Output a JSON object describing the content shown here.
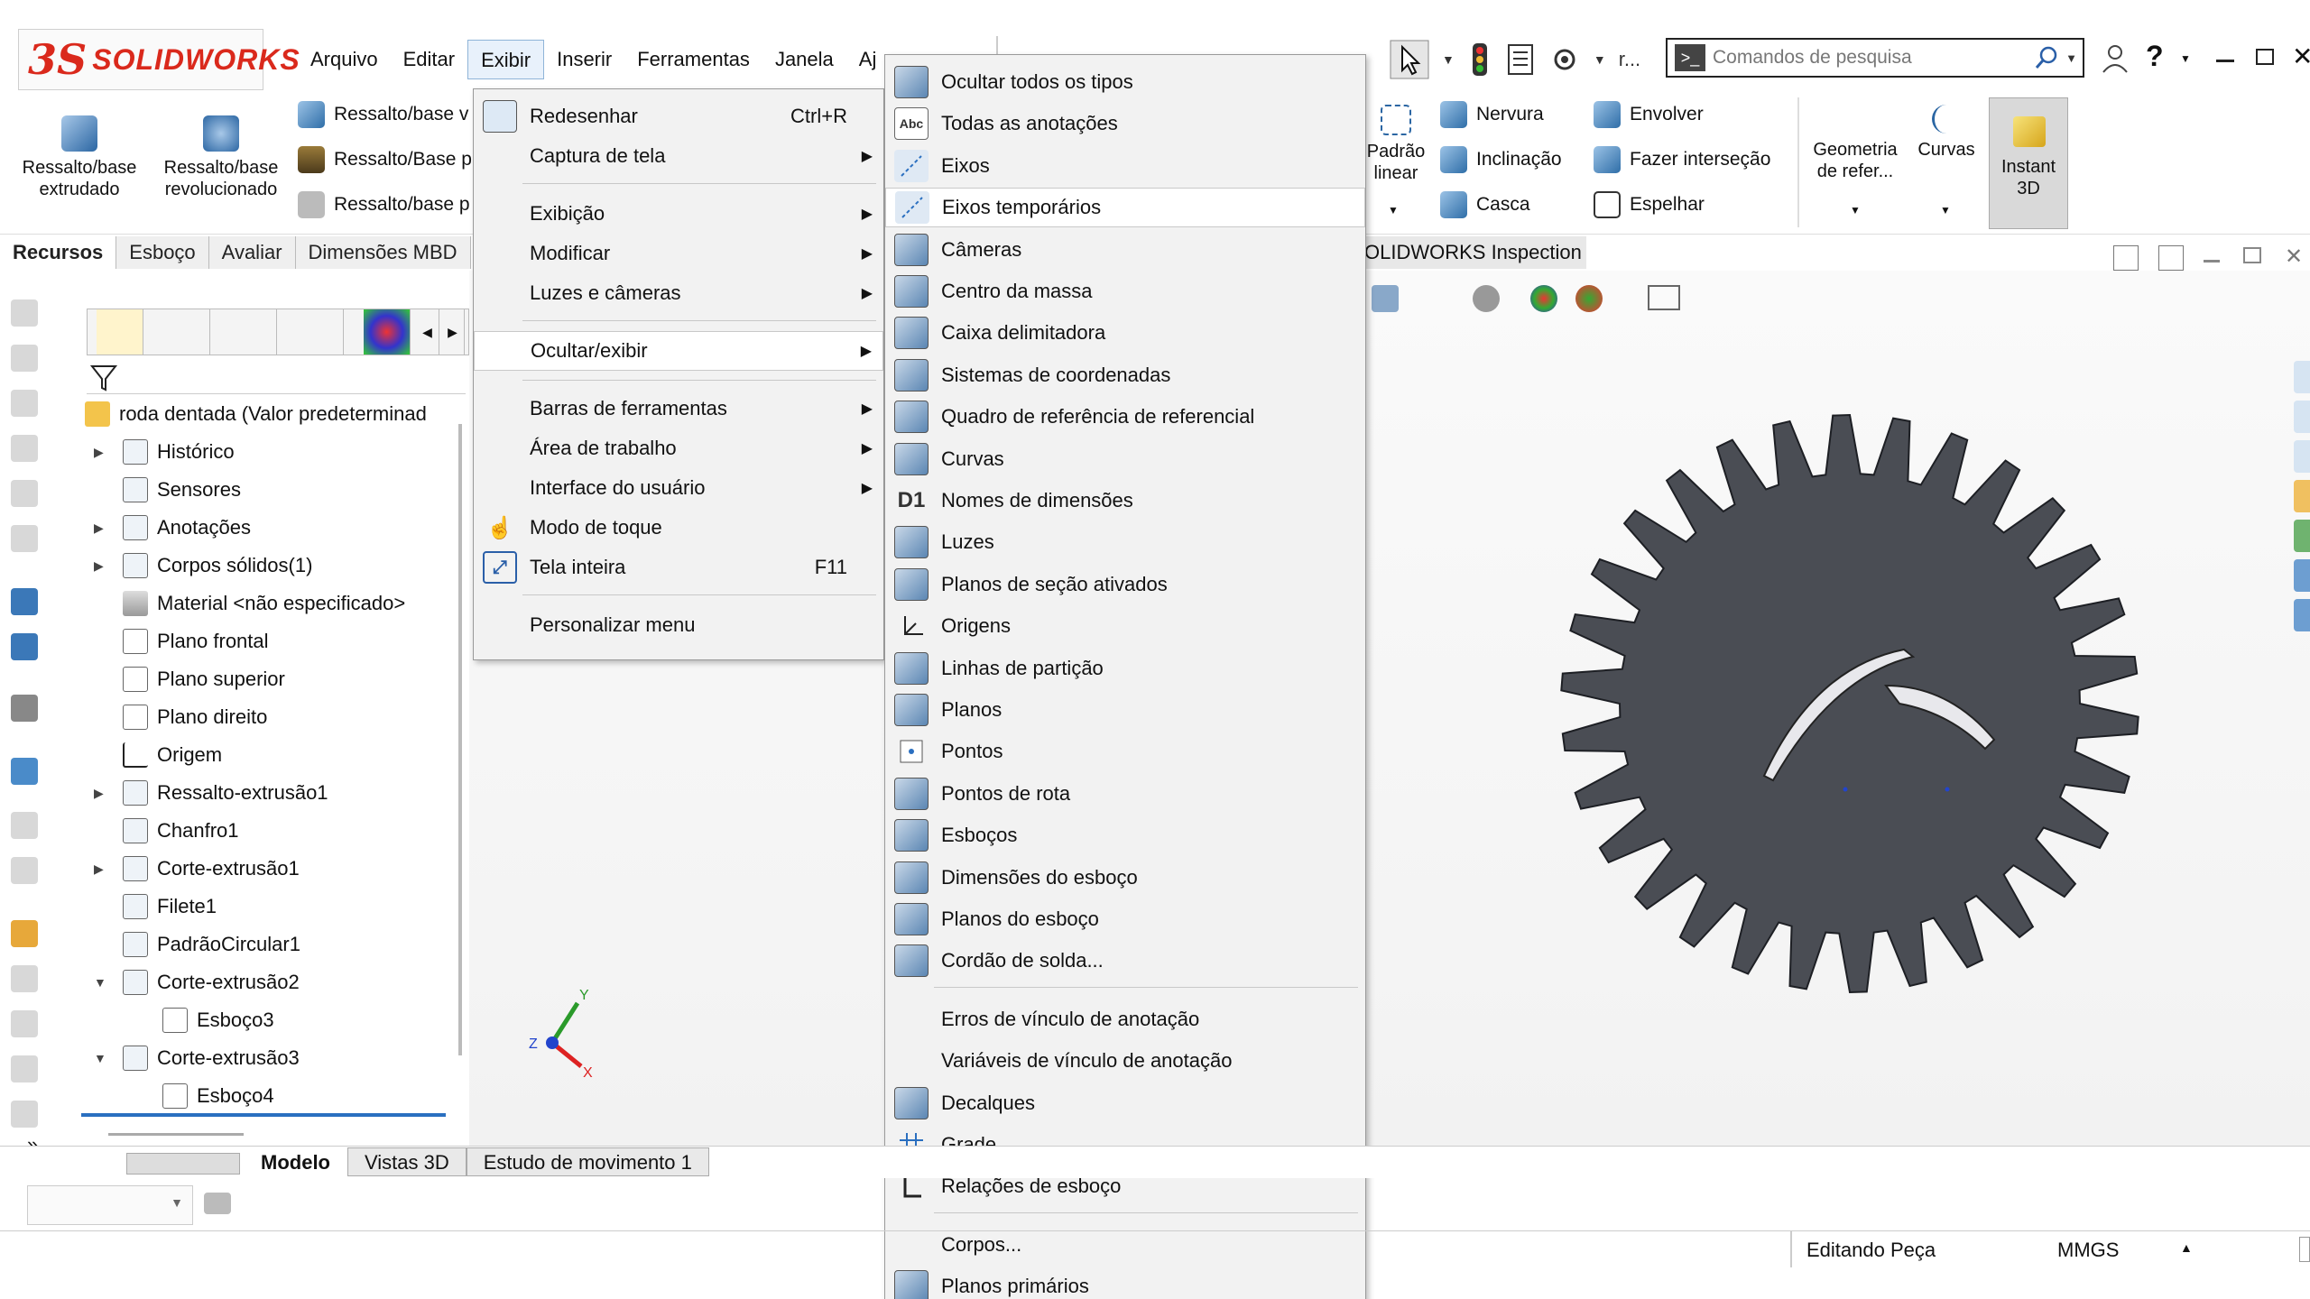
{
  "app": {
    "logo_ds": "3S",
    "logo_text": "SOLIDWORKS"
  },
  "menubar": [
    "Arquivo",
    "Editar",
    "Exibir",
    "Inserir",
    "Ferramentas",
    "Janela",
    "Aj"
  ],
  "quick": {
    "rebuild_trunc": "r...",
    "search_placeholder": "Comandos de pesquisa"
  },
  "commands": {
    "extruded": "Ressalto/base extrudado",
    "revolved": "Ressalto/base revolucionado",
    "sweep": "Ressalto/base v",
    "loft": "Ressalto/Base p",
    "boundary": "Ressalto/base p",
    "linear_pattern": "Padrão linear",
    "rib": "Nervura",
    "draft": "Inclinação",
    "shell": "Casca",
    "wrap": "Envolver",
    "intersect": "Fazer interseção",
    "mirror": "Espelhar",
    "ref_geometry": "Geometria de refer...",
    "curves": "Curvas",
    "instant3d": "Instant 3D"
  },
  "tabs": [
    "Recursos",
    "Esboço",
    "Avaliar",
    "Dimensões MBD"
  ],
  "inspection_tab": "OLIDWORKS Inspection",
  "tree": {
    "root": "roda dentada  (Valor predeterminad",
    "items": [
      "Histórico",
      "Sensores",
      "Anotações",
      "Corpos sólidos(1)",
      "Material <não especificado>",
      "Plano frontal",
      "Plano superior",
      "Plano direito",
      "Origem",
      "Ressalto-extrusão1",
      "Chanfro1",
      "Corte-extrusão1",
      "Filete1",
      "PadrãoCircular1",
      "Corte-extrusão2",
      "Esboço3",
      "Corte-extrusão3",
      "Esboço4"
    ]
  },
  "exibir_menu": [
    {
      "label": "Redesenhar",
      "shortcut": "Ctrl+R"
    },
    {
      "label": "Captura de tela"
    },
    {
      "label": "Exibição"
    },
    {
      "label": "Modificar"
    },
    {
      "label": "Luzes e câmeras"
    },
    {
      "label": "Ocultar/exibir"
    },
    {
      "label": "Barras de ferramentas"
    },
    {
      "label": "Área de trabalho"
    },
    {
      "label": "Interface do usuário"
    },
    {
      "label": "Modo de toque"
    },
    {
      "label": "Tela inteira",
      "shortcut": "F11"
    },
    {
      "label": "Personalizar menu"
    }
  ],
  "hide_show_menu": [
    "Ocultar todos os tipos",
    "Todas as anotações",
    "Eixos",
    "Eixos temporários",
    "Câmeras",
    "Centro da massa",
    "Caixa delimitadora",
    "Sistemas de coordenadas",
    "Quadro de referência de referencial",
    "Curvas",
    "Nomes de dimensões",
    "Luzes",
    "Planos de seção ativados",
    "Origens",
    "Linhas de partição",
    "Planos",
    "Pontos",
    "Pontos de rota",
    "Esboços",
    "Dimensões do esboço",
    "Planos do esboço",
    "Cordão de solda...",
    "Erros de vínculo de anotação",
    "Variáveis de vínculo de anotação",
    "Decalques",
    "Grade",
    "Relações de esboço",
    "Corpos...",
    "Planos primários"
  ],
  "hide_show_icon_labels": {
    "abc": "Abc",
    "d1": "D1"
  },
  "bottom_tabs": [
    "Modelo",
    "Vistas 3D",
    "Estudo de movimento 1"
  ],
  "status": {
    "editing": "Editando Peça",
    "units": "MMGS"
  },
  "triad": {
    "x": "X",
    "y": "Y",
    "z": "Z"
  },
  "colors": {
    "accent": "#da291c",
    "gear": "#4a4d54",
    "highlight": "#ffffff"
  }
}
